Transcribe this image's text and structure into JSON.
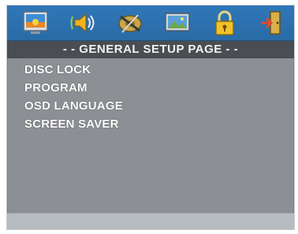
{
  "title": "- - GENERAL SETUP PAGE - -",
  "tabs": [
    {
      "icon": "general-setup-icon",
      "active": true
    },
    {
      "icon": "audio-setup-icon",
      "active": false
    },
    {
      "icon": "video-setup-icon",
      "active": false
    },
    {
      "icon": "preference-icon",
      "active": false
    },
    {
      "icon": "lock-icon",
      "active": false
    },
    {
      "icon": "exit-icon",
      "active": false
    }
  ],
  "menu": {
    "items": [
      "DISC LOCK",
      "PROGRAM",
      "OSD LANGUAGE",
      "SCREEN SAVER"
    ]
  },
  "colors": {
    "panel": "#8c8f93",
    "icon_bar": "#2f77b8",
    "title_bar": "#4a4d51",
    "text": "#ffffff"
  }
}
